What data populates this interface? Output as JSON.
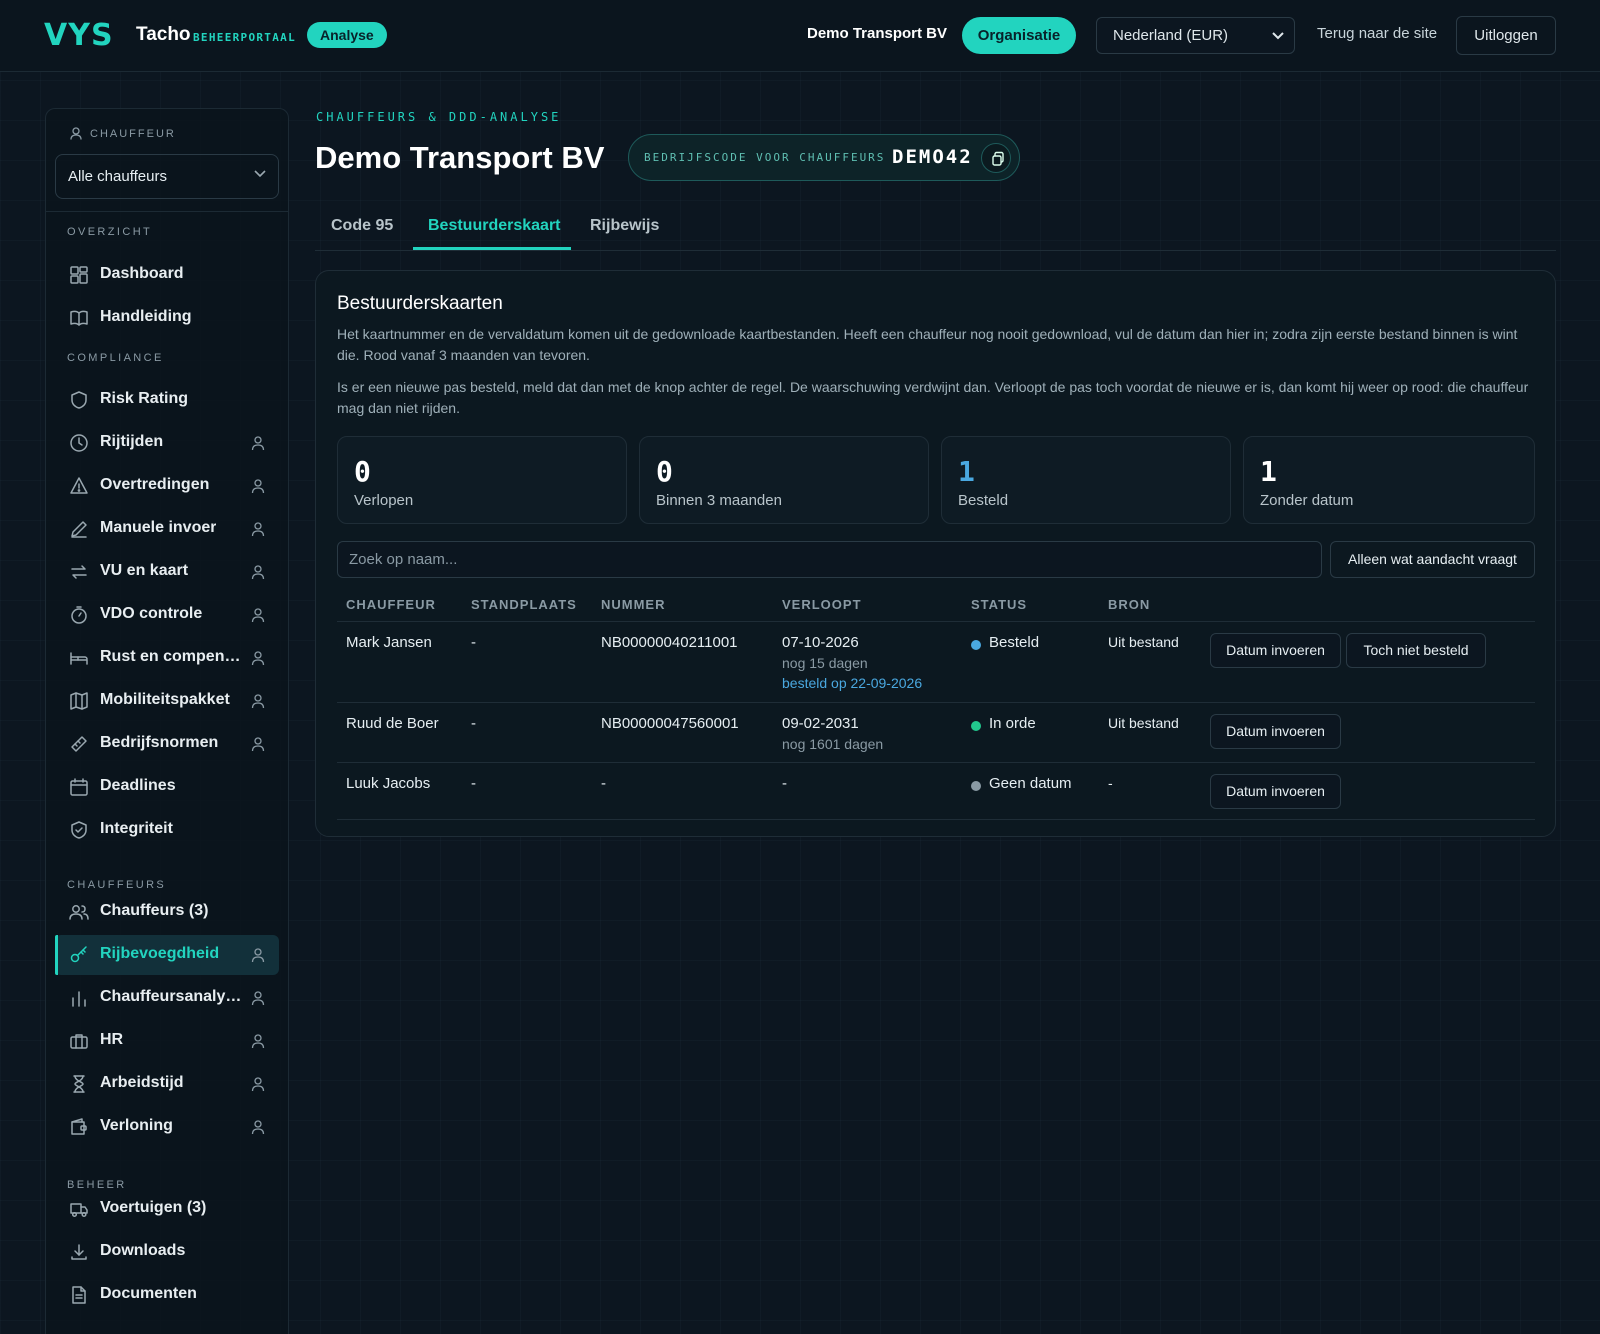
{
  "header": {
    "logo": "VYS",
    "brand": "Tacho",
    "brand_sub": "BEHEERPORTAAL",
    "mode_badge": "Analyse",
    "org_name": "Demo Transport BV",
    "org_button": "Organisatie",
    "country_select": "Nederland (EUR)",
    "back_link": "Terug naar de site",
    "logout": "Uitloggen"
  },
  "sidebar": {
    "driver_label": "CHAUFFEUR",
    "driver_select": "Alle chauffeurs",
    "sections": {
      "overview": "OVERZICHT",
      "compliance": "COMPLIANCE",
      "drivers": "CHAUFFEURS",
      "admin": "BEHEER"
    },
    "items": [
      {
        "label": "Dashboard",
        "icon": "grid-icon"
      },
      {
        "label": "Handleiding",
        "icon": "book-icon"
      },
      {
        "label": "Risk Rating",
        "icon": "shield-icon"
      },
      {
        "label": "Rijtijden",
        "icon": "clock-icon"
      },
      {
        "label": "Overtredingen",
        "icon": "warning-icon"
      },
      {
        "label": "Manuele invoer",
        "icon": "pencil-icon"
      },
      {
        "label": "VU en kaart",
        "icon": "swap-icon"
      },
      {
        "label": "VDO controle",
        "icon": "stopwatch-icon"
      },
      {
        "label": "Rust en compensatie",
        "icon": "bed-icon"
      },
      {
        "label": "Mobiliteitspakket",
        "icon": "map-icon"
      },
      {
        "label": "Bedrijfsnormen",
        "icon": "ruler-icon"
      },
      {
        "label": "Deadlines",
        "icon": "calendar-icon"
      },
      {
        "label": "Integriteit",
        "icon": "shield-check-icon"
      },
      {
        "label": "Chauffeurs (3)",
        "icon": "users-icon"
      },
      {
        "label": "Rijbevoegdheid",
        "icon": "key-icon"
      },
      {
        "label": "Chauffeursanalyse",
        "icon": "bar-chart-icon"
      },
      {
        "label": "HR",
        "icon": "briefcase-icon"
      },
      {
        "label": "Arbeidstijd",
        "icon": "hourglass-icon"
      },
      {
        "label": "Verloning",
        "icon": "wallet-icon"
      },
      {
        "label": "Voertuigen (3)",
        "icon": "truck-icon"
      },
      {
        "label": "Downloads",
        "icon": "download-icon"
      },
      {
        "label": "Documenten",
        "icon": "document-icon"
      }
    ]
  },
  "main": {
    "breadcrumb": "CHAUFFEURS & DDD-ANALYSE",
    "title": "Demo Transport BV",
    "company_code_label": "BEDRIJFSCODE VOOR CHAUFFEURS",
    "company_code": "DEMO42",
    "tabs": [
      {
        "label": "Code 95"
      },
      {
        "label": "Bestuurderskaart"
      },
      {
        "label": "Rijbewijs"
      }
    ],
    "card": {
      "title": "Bestuurderskaarten",
      "desc1": "Het kaartnummer en de vervaldatum komen uit de gedownloade kaartbestanden. Heeft een chauffeur nog nooit gedownload, vul de datum dan hier in; zodra zijn eerste bestand binnen is wint die. Rood vanaf 3 maanden van tevoren.",
      "desc2": "Is er een nieuwe pas besteld, meld dat dan met de knop achter de regel. De waarschuwing verdwijnt dan. Verloopt de pas toch voordat de nieuwe er is, dan komt hij weer op rood: die chauffeur mag dan niet rijden.",
      "stats": [
        {
          "value": "0",
          "label": "Verlopen"
        },
        {
          "value": "0",
          "label": "Binnen 3 maanden"
        },
        {
          "value": "1",
          "label": "Besteld"
        },
        {
          "value": "1",
          "label": "Zonder datum"
        }
      ],
      "search_placeholder": "Zoek op naam...",
      "filter_button": "Alleen wat aandacht vraagt",
      "columns": [
        "CHAUFFEUR",
        "STANDPLAATS",
        "NUMMER",
        "VERLOOPT",
        "STATUS",
        "BRON"
      ],
      "rows": [
        {
          "driver": "Mark Jansen",
          "location": "-",
          "number": "NB00000040211001",
          "expires": "07-10-2026",
          "expires_sub": "nog 15 dagen",
          "ordered": "besteld op 22-09-2026",
          "status": "Besteld",
          "status_color": "#4aa8e0",
          "source": "Uit bestand",
          "btn1": "Datum invoeren",
          "btn2": "Toch niet besteld"
        },
        {
          "driver": "Ruud de Boer",
          "location": "-",
          "number": "NB00000047560001",
          "expires": "09-02-2031",
          "expires_sub": "nog 1601 dagen",
          "status": "In orde",
          "status_color": "#22c98e",
          "source": "Uit bestand",
          "btn1": "Datum invoeren"
        },
        {
          "driver": "Luuk Jacobs",
          "location": "-",
          "number": "-",
          "expires": "-",
          "status": "Geen datum",
          "status_color": "#8a9aa4",
          "source": "-",
          "btn1": "Datum invoeren"
        }
      ]
    }
  }
}
